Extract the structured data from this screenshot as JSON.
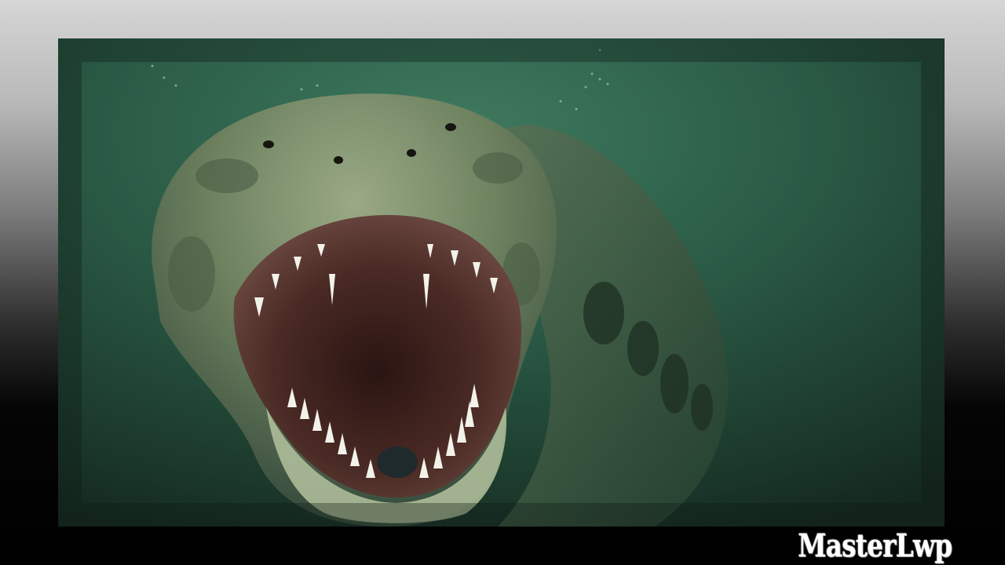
{
  "wallpaper": {
    "watermark_text": "MasterLwp",
    "subject": "giant-snake-underwater",
    "colors": {
      "water": "#2a5a45",
      "water_dark": "#14281f",
      "snake_scales": "#7b8f66",
      "mouth_interior": "#4a2a24",
      "teeth": "#f2f2ea",
      "frame_top": "#d6d6d6",
      "frame_bottom": "#000000",
      "watermark": "#ffffff"
    }
  }
}
